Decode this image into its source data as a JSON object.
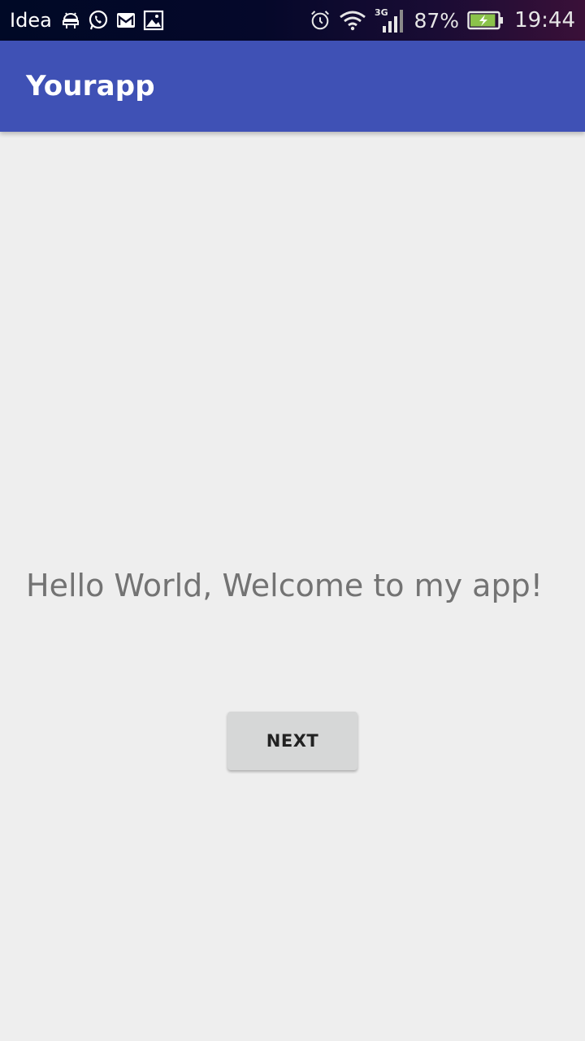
{
  "status_bar": {
    "carrier": "Idea",
    "left_icons": [
      "android-debug-icon",
      "whatsapp-icon",
      "gmail-icon",
      "gallery-icon"
    ],
    "right_icons": [
      "alarm-icon",
      "wifi-icon",
      "signal-3g-icon",
      "battery-charging-icon"
    ],
    "network_type": "3G",
    "battery_percent": "87%",
    "battery_level": 0.87,
    "time": "19:44"
  },
  "app_bar": {
    "title": "Yourapp",
    "color": "#3f51b5"
  },
  "main": {
    "welcome_text": "Hello World, Welcome to my app!",
    "next_button_label": "NEXT"
  }
}
